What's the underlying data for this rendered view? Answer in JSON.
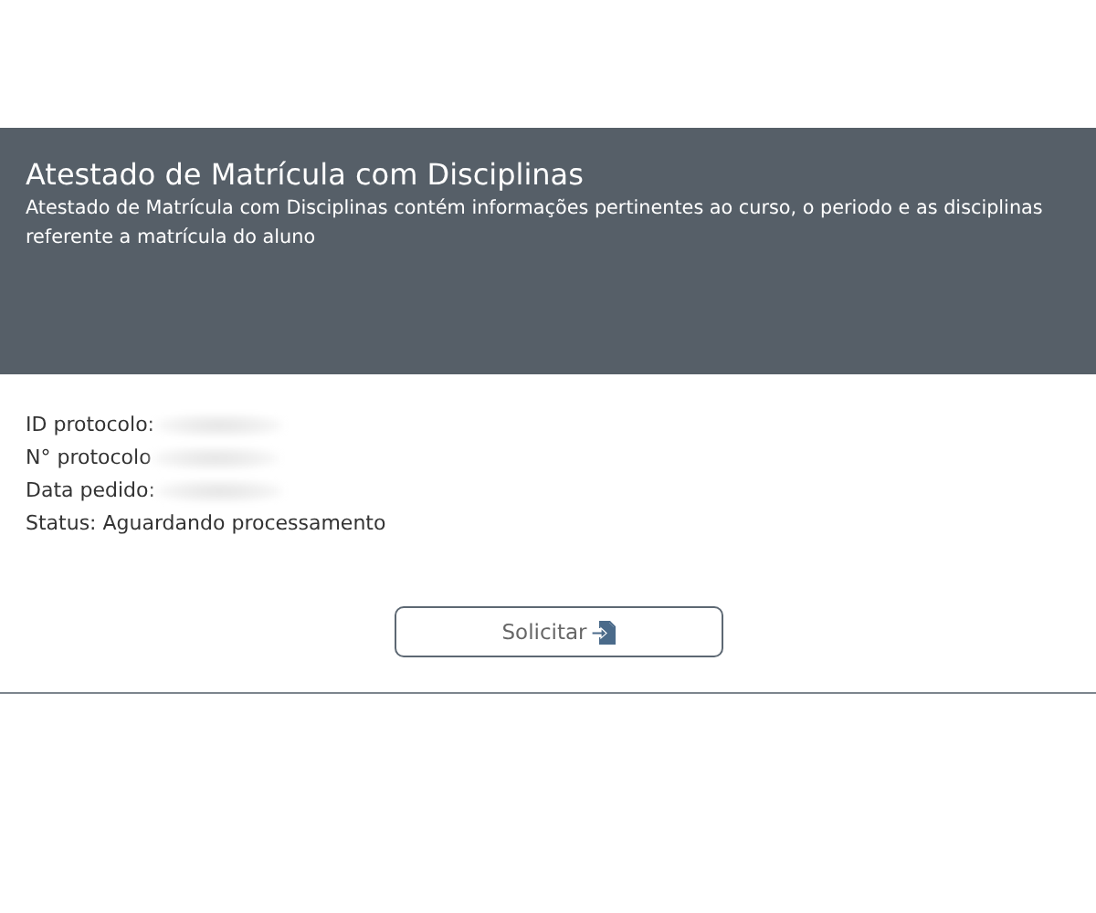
{
  "header": {
    "title": "Atestado de Matrícula com Disciplinas",
    "description": "Atestado de Matrícula com Disciplinas contém informações pertinentes ao curso, o periodo e as disciplinas referente a matrícula do aluno"
  },
  "fields": [
    {
      "label": "ID protocolo:",
      "redacted": true
    },
    {
      "label": "N° protocolo",
      "redacted": true
    },
    {
      "label": "Data pedido:",
      "redacted": true
    },
    {
      "label": "Status: Aguardando processamento",
      "redacted": false
    }
  ],
  "button": {
    "label": "Solicitar"
  }
}
